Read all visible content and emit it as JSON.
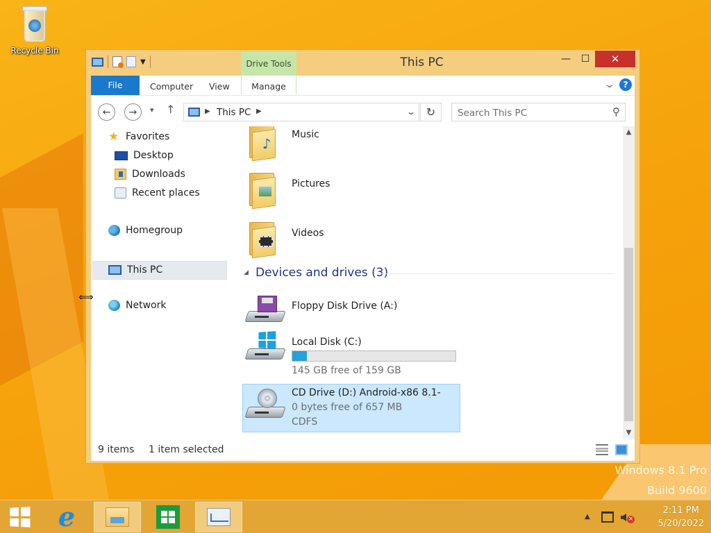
{
  "desktop": {
    "icons": [
      {
        "label": "Recycle Bin",
        "icon": "recycle-bin-icon"
      }
    ],
    "watermark": {
      "line1": "Windows 8.1 Pro",
      "line2": "Build 9600"
    }
  },
  "window": {
    "title": "This PC",
    "contextual_tab_group": "Drive Tools",
    "controls": {
      "minimize": "—",
      "maximize": "☐",
      "close": "✕"
    },
    "ribbon_tabs": [
      "File",
      "Computer",
      "View",
      "Manage"
    ],
    "address": {
      "location": "This PC"
    },
    "search": {
      "placeholder": "Search This PC"
    },
    "nav_pane": {
      "favorites": {
        "label": "Favorites",
        "items": [
          "Desktop",
          "Downloads",
          "Recent places"
        ]
      },
      "homegroup": "Homegroup",
      "this_pc": "This PC",
      "network": "Network"
    },
    "folders": [
      {
        "name": "Music",
        "icon": "music-folder-icon"
      },
      {
        "name": "Pictures",
        "icon": "pictures-folder-icon"
      },
      {
        "name": "Videos",
        "icon": "videos-folder-icon"
      }
    ],
    "devices_group": {
      "label": "Devices and drives (3)"
    },
    "drives": [
      {
        "name": "Floppy Disk Drive (A:)",
        "icon": "floppy-drive-icon"
      },
      {
        "name": "Local Disk (C:)",
        "icon": "local-disk-icon",
        "space": "145 GB free of 159 GB",
        "used_fraction": 0.088
      },
      {
        "name": "CD Drive (D:) Android-x86 8.1-",
        "icon": "cd-drive-icon",
        "space": "0 bytes free of 657 MB",
        "filesystem": "CDFS",
        "selected": true
      }
    ],
    "status": {
      "count": "9 items",
      "selection": "1 item selected"
    }
  },
  "taskbar": {
    "items": [
      "start-button",
      "internet-explorer",
      "file-explorer",
      "store",
      "performance-monitor"
    ],
    "active": "file-explorer",
    "clock": {
      "time": "2:11 PM",
      "date": "5/20/2022"
    }
  },
  "colors": {
    "accent": "#1979ca",
    "selection": "#cce8ff",
    "desktop": "#f6a20b",
    "close": "#c7302b",
    "drive_tools": "#c6e6a8"
  }
}
